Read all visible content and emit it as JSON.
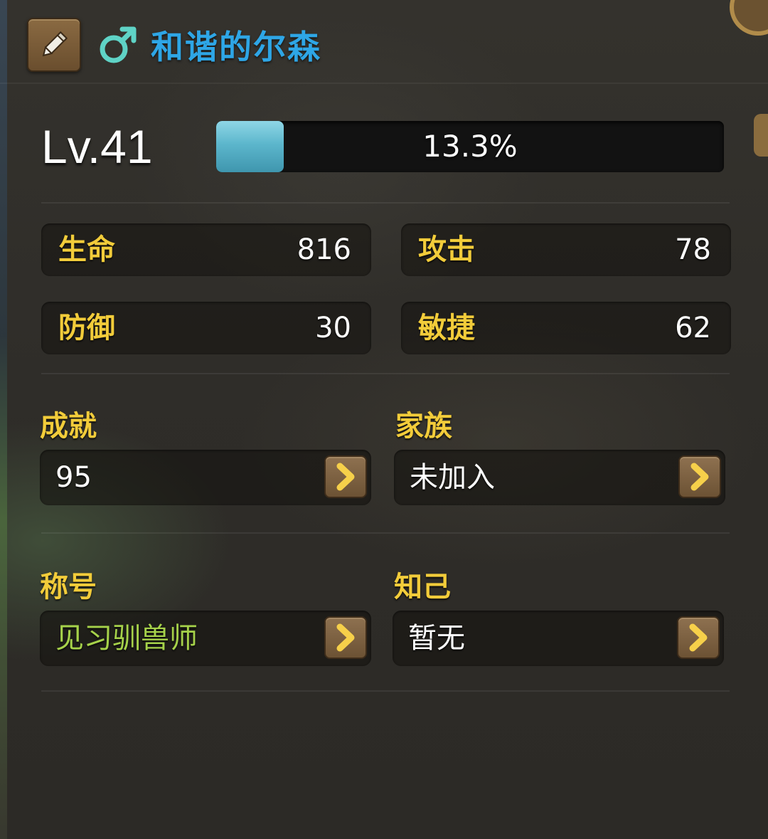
{
  "header": {
    "edit_icon": "pencil-icon",
    "gender_icon": "male-icon",
    "player_name": "和谐的尔森"
  },
  "level": {
    "label": "Lv.41",
    "xp_percent_text": "13.3%",
    "xp_fraction": 0.133
  },
  "stats": {
    "hp_label": "生命",
    "hp_value": "816",
    "attack_label": "攻击",
    "attack_value": "78",
    "defense_label": "防御",
    "defense_value": "30",
    "agility_label": "敏捷",
    "agility_value": "62"
  },
  "info": {
    "achievement_label": "成就",
    "achievement_value": "95",
    "family_label": "家族",
    "family_value": "未加入",
    "title_label": "称号",
    "title_value": "见习驯兽师",
    "friend_label": "知己",
    "friend_value": "暂无"
  },
  "colors": {
    "name": "#2ea6e6",
    "label": "#f2cc3a",
    "title_value": "#a6d24a",
    "xp_fill": "#5cb6cc"
  }
}
